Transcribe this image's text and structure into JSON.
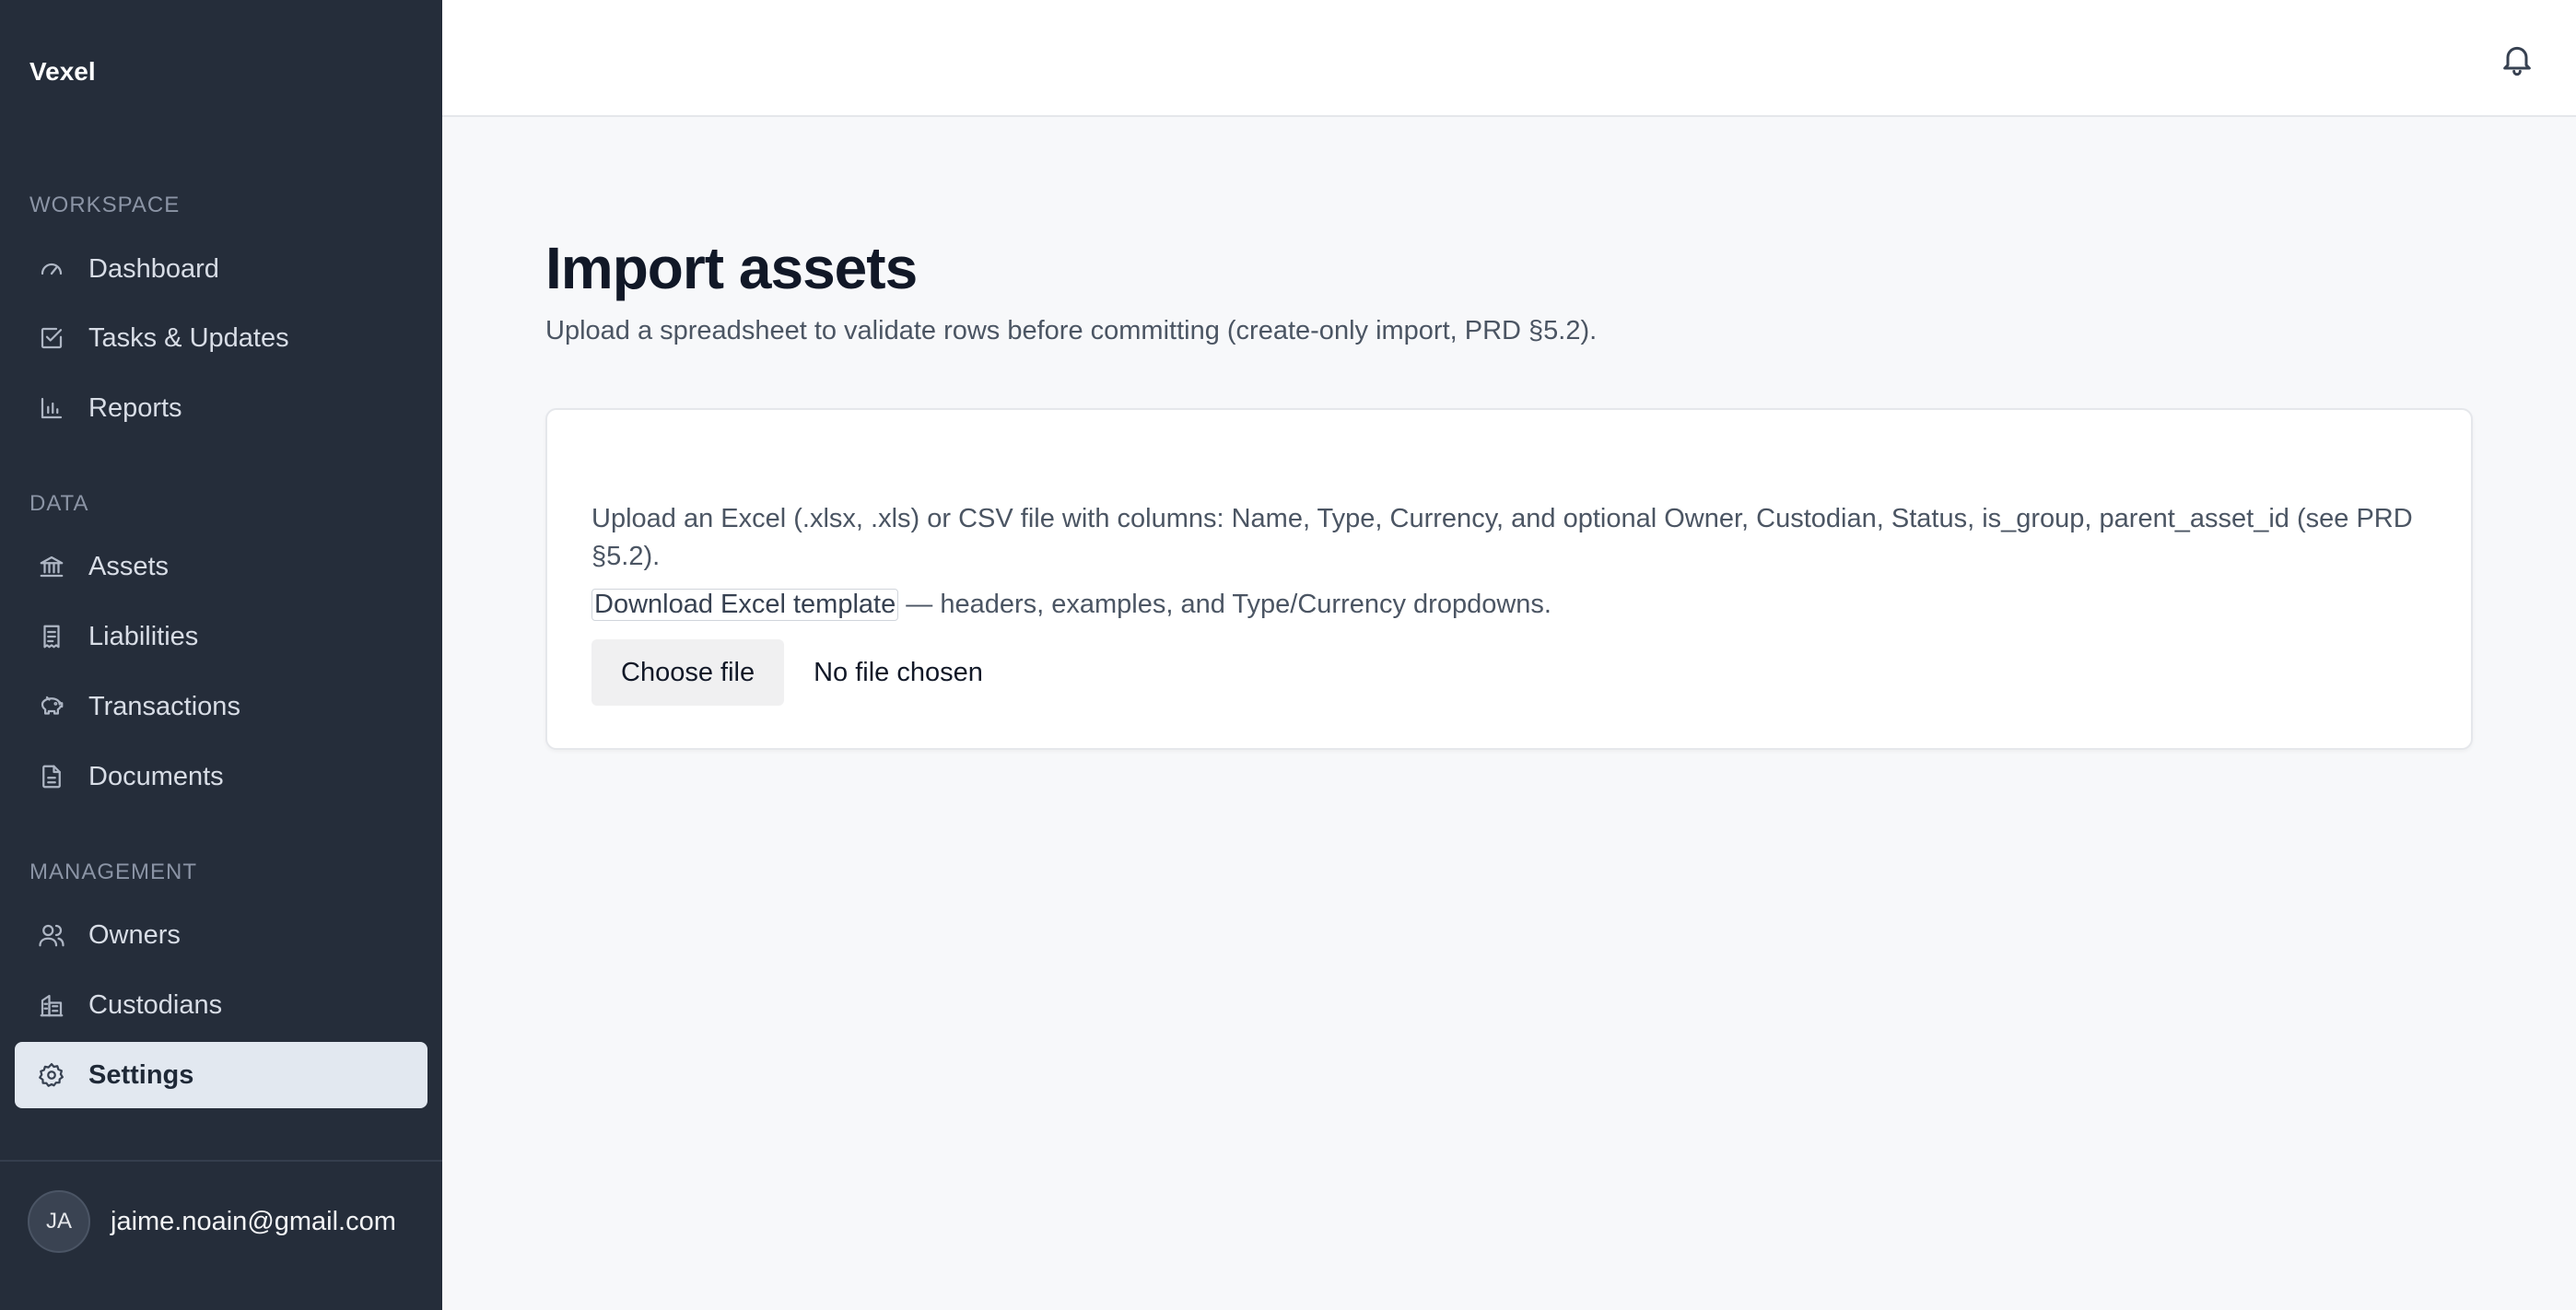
{
  "app": {
    "brand": "Vexel"
  },
  "sidebar": {
    "sections": [
      {
        "title": "WORKSPACE"
      },
      {
        "title": "DATA"
      },
      {
        "title": "MANAGEMENT"
      }
    ],
    "items": [
      {
        "label": "Dashboard",
        "icon": "gauge-icon"
      },
      {
        "label": "Tasks & Updates",
        "icon": "checkbox-icon"
      },
      {
        "label": "Reports",
        "icon": "bar-chart-icon"
      },
      {
        "label": "Assets",
        "icon": "bank-icon"
      },
      {
        "label": "Liabilities",
        "icon": "receipt-icon"
      },
      {
        "label": "Transactions",
        "icon": "piggy-bank-icon"
      },
      {
        "label": "Documents",
        "icon": "document-icon"
      },
      {
        "label": "Owners",
        "icon": "users-icon"
      },
      {
        "label": "Custodians",
        "icon": "building-icon"
      },
      {
        "label": "Settings",
        "icon": "gear-icon",
        "active": true
      }
    ],
    "user": {
      "initials": "JA",
      "email": "jaime.noain@gmail.com"
    }
  },
  "header": {
    "notifications_icon": "bell-icon"
  },
  "main": {
    "title": "Import assets",
    "subtitle": "Upload a spreadsheet to validate rows before committing (create-only import, PRD §5.2).",
    "card": {
      "description": "Upload an Excel (.xlsx, .xls) or CSV file with columns: Name, Type, Currency, and optional Owner, Custodian, Status, is_group, parent_asset_id (see PRD §5.2).",
      "template_link": "Download Excel template",
      "template_suffix": " — headers, examples, and Type/Currency dropdowns.",
      "choose_file_label": "Choose file",
      "file_status": "No file chosen"
    }
  },
  "colors": {
    "sidebar_bg": "#252d3a",
    "active_item_bg": "#e2e8f0",
    "page_bg": "#f7f8fa"
  }
}
